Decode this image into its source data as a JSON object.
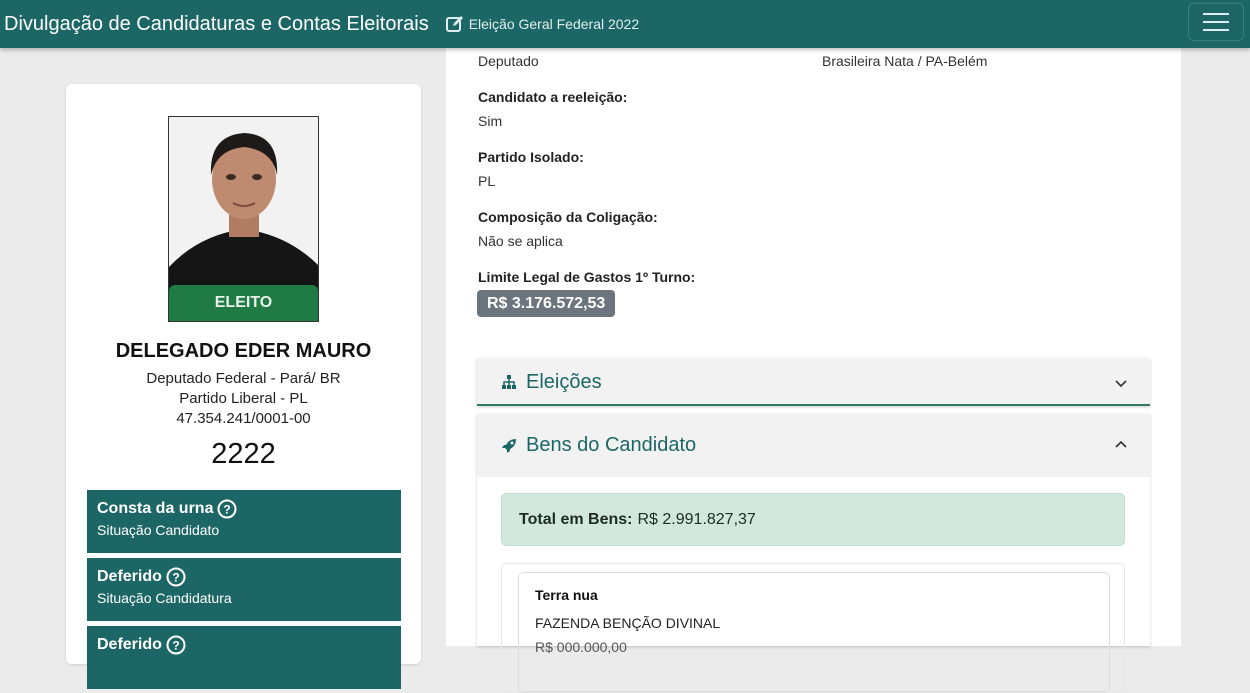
{
  "header": {
    "title": "Divulgação de Candidaturas e Contas Eleitorais",
    "election": "Eleição Geral Federal 2022",
    "edit_icon": "edit-icon",
    "menu_icon": "hamburger-icon"
  },
  "candidate": {
    "badge": "ELEITO",
    "name": "DELEGADO EDER MAURO",
    "office": "Deputado Federal - Pará/ BR",
    "party": "Partido Liberal - PL",
    "cnpj": "47.354.241/0001-00",
    "number": "2222"
  },
  "status_cards": [
    {
      "title": "Consta da urna",
      "subtitle": "Situação Candidato"
    },
    {
      "title": "Deferido",
      "subtitle": "Situação Candidatura"
    },
    {
      "title": "Deferido",
      "subtitle": ""
    }
  ],
  "details": {
    "occupation_value": "Deputado",
    "nationality_value": "Brasileira Nata / PA-Belém",
    "reelection_label": "Candidato a reeleição:",
    "reelection_value": "Sim",
    "party_label": "Partido Isolado:",
    "party_value": "PL",
    "coalition_label": "Composição da Coligação:",
    "coalition_value": "Não se aplica",
    "limit_label": "Limite Legal de Gastos 1º Turno:",
    "limit_value": "R$ 3.176.572,53"
  },
  "accordions": {
    "eleicoes": {
      "title": "Eleições",
      "icon": "sitemap-icon",
      "expanded": false
    },
    "bens": {
      "title": "Bens do Candidato",
      "icon": "rocket-icon",
      "expanded": true
    }
  },
  "bens": {
    "total_label": "Total em Bens:",
    "total_value": "R$ 2.991.827,37",
    "items": [
      {
        "type": "Terra nua",
        "description": "FAZENDA BENÇÃO DIVINAL",
        "value": "R$ 000.000,00"
      }
    ]
  },
  "colors": {
    "header": "#1c6766",
    "accent": "#1c6766",
    "eleito": "#1f7a44",
    "total_bg": "#d2e8dd"
  }
}
